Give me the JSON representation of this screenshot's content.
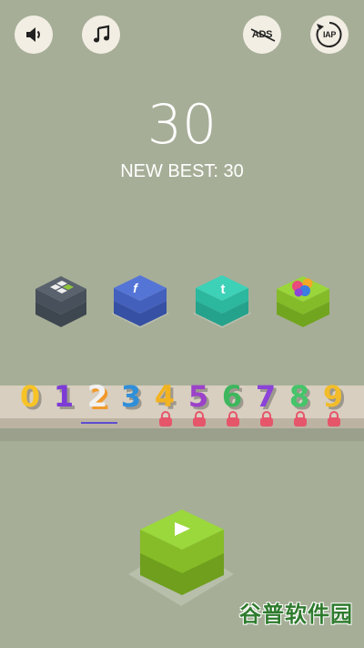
{
  "header": {
    "sound_icon": "speaker-icon",
    "music_icon": "music-note-icon",
    "no_ads_label": "ADS",
    "iap_label": "IAP"
  },
  "score": {
    "current": "30",
    "best_text": "NEW BEST: 30"
  },
  "social_cubes": [
    {
      "name": "leaderboard",
      "icon": "grid-icon",
      "top": "#525a66",
      "side": "#3e4650"
    },
    {
      "name": "facebook",
      "icon": "f",
      "top": "#4c6ad0",
      "side": "#3b55ad"
    },
    {
      "name": "tumblr",
      "icon": "t",
      "top": "#35cbb2",
      "side": "#27a792"
    },
    {
      "name": "game-center",
      "icon": "bubbles-icon",
      "top": "#96cf36",
      "side": "#78ad22"
    }
  ],
  "characters": [
    {
      "glyph": "0",
      "color": "#f7c327",
      "locked": false
    },
    {
      "glyph": "1",
      "color": "#7d3bd6",
      "locked": false
    },
    {
      "glyph": "2",
      "color": "#f1f1f1",
      "locked": false,
      "selected": true
    },
    {
      "glyph": "3",
      "color": "#2f8fd9",
      "locked": false
    },
    {
      "glyph": "4",
      "color": "#f2b321",
      "locked": true
    },
    {
      "glyph": "5",
      "color": "#9b42c9",
      "locked": true
    },
    {
      "glyph": "6",
      "color": "#3eb65d",
      "locked": true
    },
    {
      "glyph": "7",
      "color": "#8b43d8",
      "locked": true
    },
    {
      "glyph": "8",
      "color": "#45c46a",
      "locked": true
    },
    {
      "glyph": "9",
      "color": "#f2bc2a",
      "locked": true
    }
  ],
  "play": {
    "icon": "play-icon",
    "top": "#96cf36",
    "side": "#78ad22"
  },
  "watermark": "谷普软件园",
  "colors": {
    "background": "#a6ae97",
    "lock": "#e6566b",
    "selection": "#5d4dcf"
  }
}
